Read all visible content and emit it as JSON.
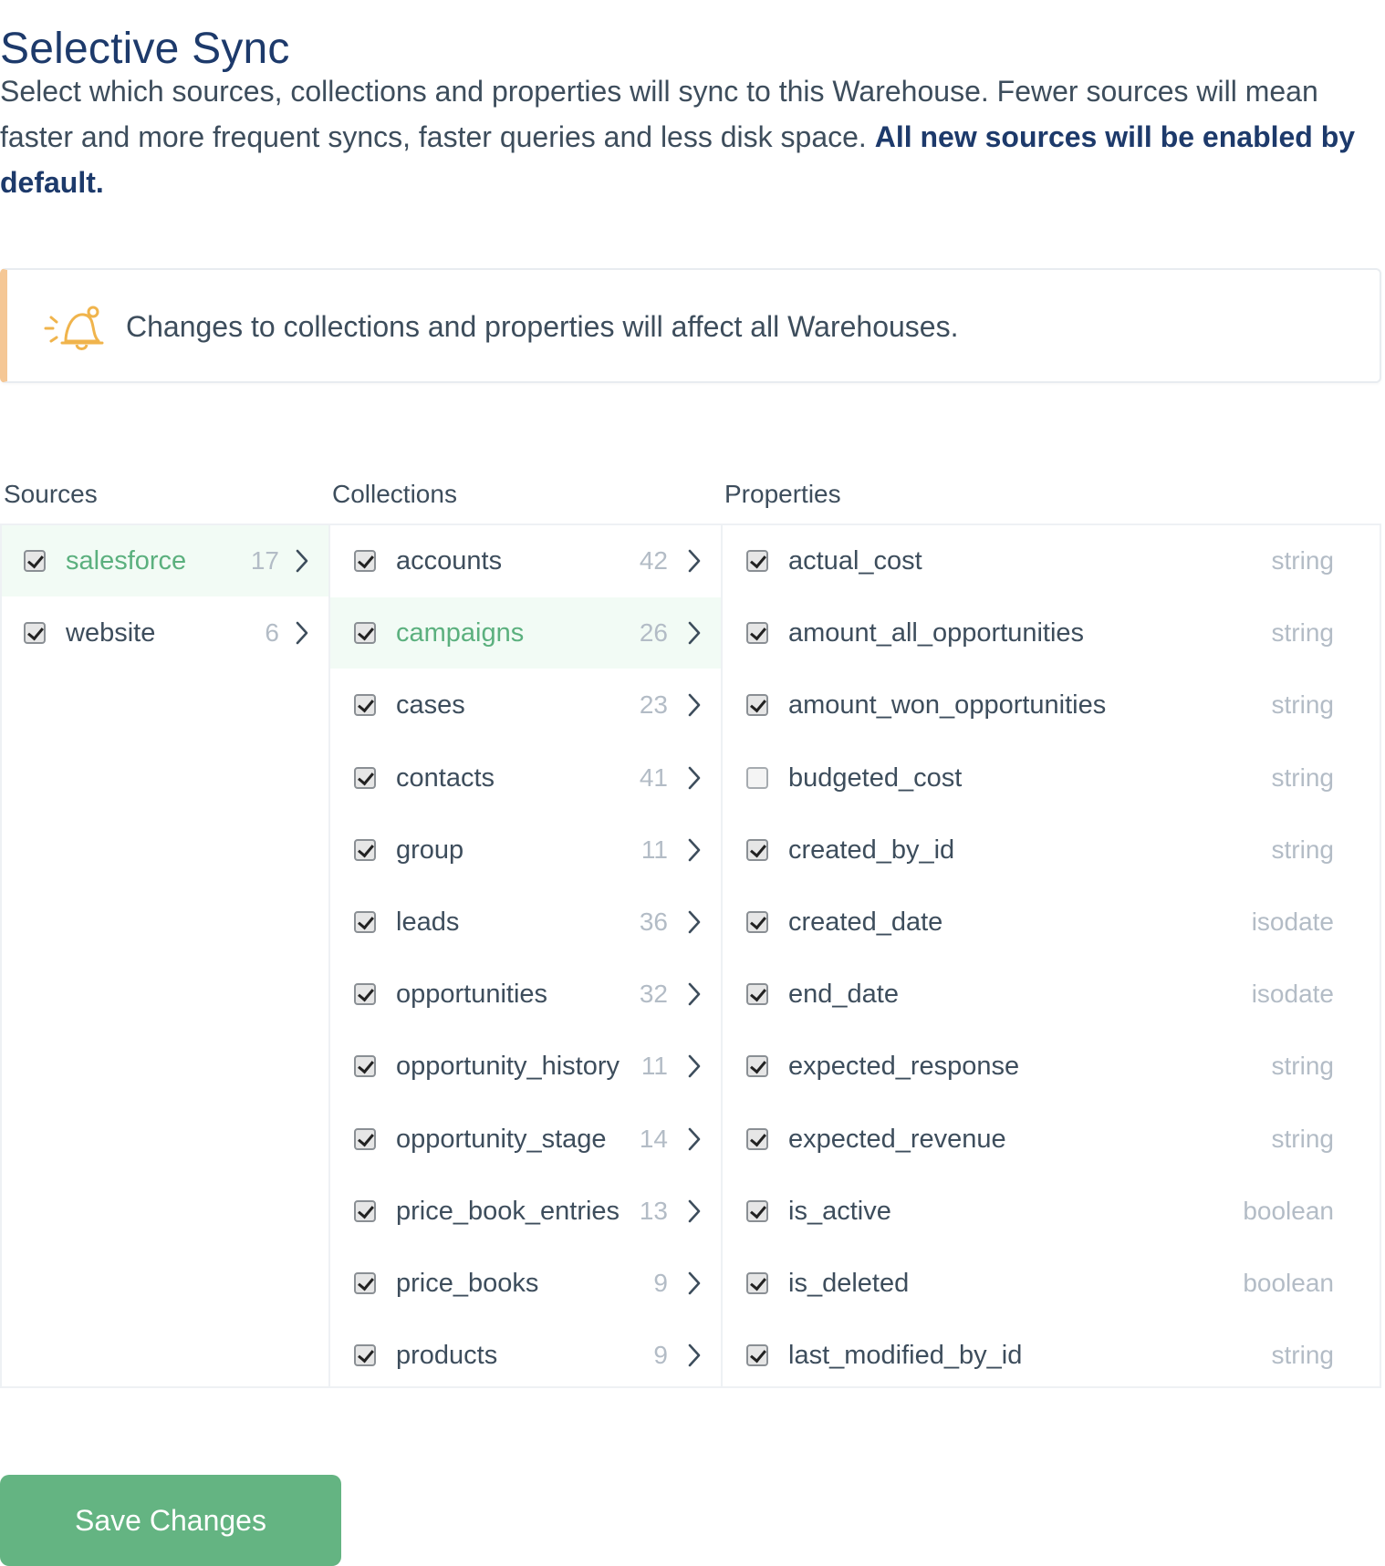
{
  "page": {
    "title": "Selective Sync",
    "description": "Select which sources, collections and properties will sync to this Warehouse. Fewer sources will mean faster and more frequent syncs, faster queries and less disk space.",
    "description_bold": "All new sources will be enabled by default."
  },
  "alert": {
    "icon": "bell-icon",
    "message": "Changes to collections and properties will affect all Warehouses."
  },
  "headers": {
    "sources": "Sources",
    "collections": "Collections",
    "properties": "Properties"
  },
  "sources": [
    {
      "name": "salesforce",
      "count": "17",
      "checked": true,
      "selected": true
    },
    {
      "name": "website",
      "count": "6",
      "checked": true,
      "selected": false
    }
  ],
  "collections": [
    {
      "name": "accounts",
      "count": "42",
      "checked": true,
      "selected": false
    },
    {
      "name": "campaigns",
      "count": "26",
      "checked": true,
      "selected": true
    },
    {
      "name": "cases",
      "count": "23",
      "checked": true,
      "selected": false
    },
    {
      "name": "contacts",
      "count": "41",
      "checked": true,
      "selected": false
    },
    {
      "name": "group",
      "count": "11",
      "checked": true,
      "selected": false
    },
    {
      "name": "leads",
      "count": "36",
      "checked": true,
      "selected": false
    },
    {
      "name": "opportunities",
      "count": "32",
      "checked": true,
      "selected": false
    },
    {
      "name": "opportunity_history",
      "count": "11",
      "checked": true,
      "selected": false
    },
    {
      "name": "opportunity_stage",
      "count": "14",
      "checked": true,
      "selected": false
    },
    {
      "name": "price_book_entries",
      "count": "13",
      "checked": true,
      "selected": false
    },
    {
      "name": "price_books",
      "count": "9",
      "checked": true,
      "selected": false
    },
    {
      "name": "products",
      "count": "9",
      "checked": true,
      "selected": false
    }
  ],
  "properties": [
    {
      "name": "actual_cost",
      "type": "string",
      "checked": true
    },
    {
      "name": "amount_all_opportunities",
      "type": "string",
      "checked": true
    },
    {
      "name": "amount_won_opportunities",
      "type": "string",
      "checked": true
    },
    {
      "name": "budgeted_cost",
      "type": "string",
      "checked": false
    },
    {
      "name": "created_by_id",
      "type": "string",
      "checked": true
    },
    {
      "name": "created_date",
      "type": "isodate",
      "checked": true
    },
    {
      "name": "end_date",
      "type": "isodate",
      "checked": true
    },
    {
      "name": "expected_response",
      "type": "string",
      "checked": true
    },
    {
      "name": "expected_revenue",
      "type": "string",
      "checked": true
    },
    {
      "name": "is_active",
      "type": "boolean",
      "checked": true
    },
    {
      "name": "is_deleted",
      "type": "boolean",
      "checked": true
    },
    {
      "name": "last_modified_by_id",
      "type": "string",
      "checked": true
    }
  ],
  "actions": {
    "save_label": "Save Changes"
  },
  "colors": {
    "accent_green": "#64b482",
    "title_navy": "#1d3a6b",
    "alert_border": "#f5c795"
  }
}
